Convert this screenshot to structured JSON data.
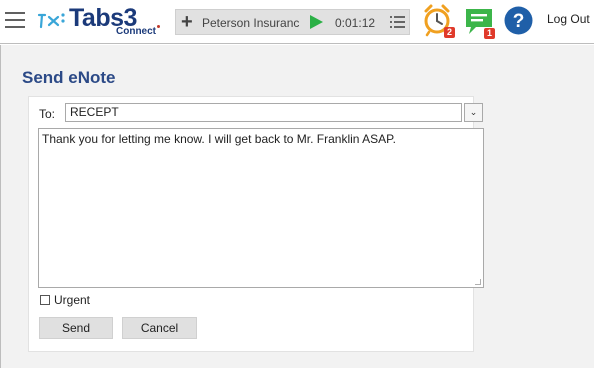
{
  "header": {
    "logo_text": "Tabs3",
    "logo_sub": "Connect",
    "timer": {
      "client": "Peterson Insuranc",
      "elapsed": "0:01:12"
    },
    "reminders_badge": "2",
    "messages_badge": "1",
    "logout_label": "Log Out"
  },
  "page": {
    "title": "Send eNote"
  },
  "form": {
    "to_label": "To:",
    "to_value": "RECEPT",
    "message": "Thank you for letting me know. I will get back to Mr. Franklin ASAP.",
    "urgent_label": "Urgent",
    "urgent_checked": false,
    "send_label": "Send",
    "cancel_label": "Cancel"
  },
  "colors": {
    "brand": "#1b3a7a",
    "title": "#2c4a87",
    "play": "#2bb046",
    "badge": "#e03a2b",
    "messages_icon": "#3cb54a",
    "help_icon": "#1f5fa8"
  }
}
